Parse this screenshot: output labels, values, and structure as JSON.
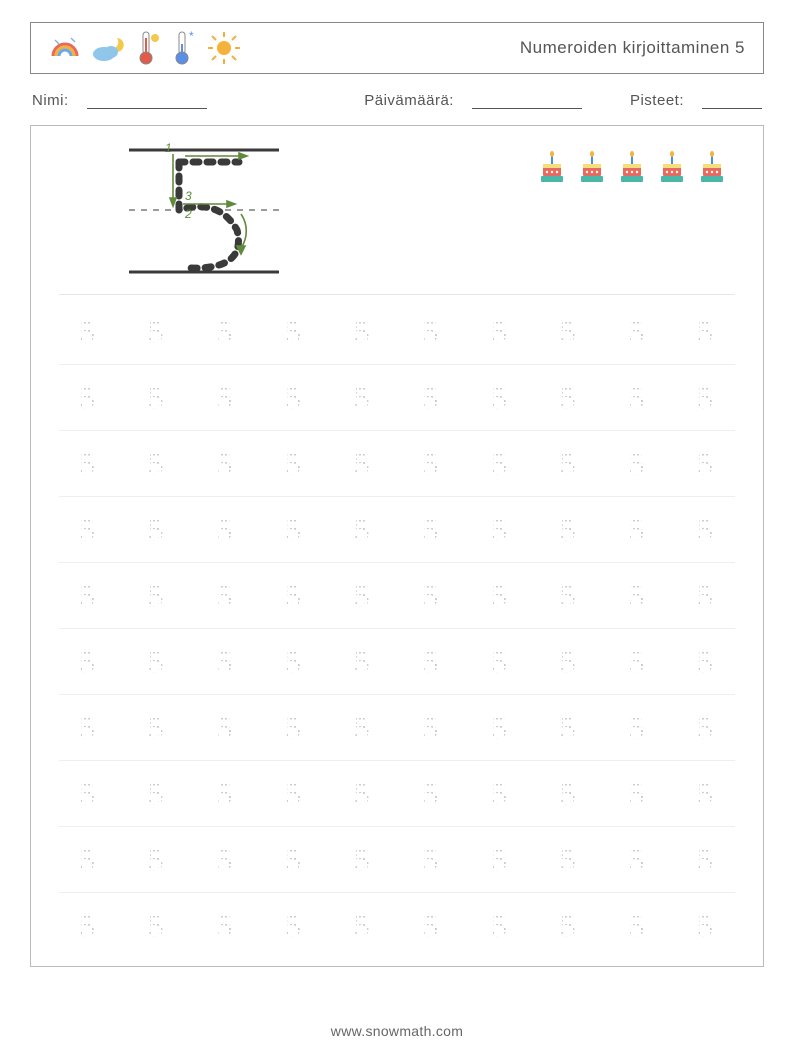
{
  "header": {
    "title": "Numeroiden kirjoittaminen 5",
    "icons": [
      "rainbow-icon",
      "cloud-moon-icon",
      "thermometer-hot-icon",
      "thermometer-cold-icon",
      "sun-icon"
    ]
  },
  "meta": {
    "name_label": "Nimi:",
    "date_label": "Päivämäärä:",
    "score_label": "Pisteet:"
  },
  "example": {
    "number": "5",
    "stroke_labels": [
      "1",
      "2",
      "3"
    ],
    "candle_count": 5
  },
  "practice": {
    "rows": 10,
    "cols": 10,
    "glyph": "5"
  },
  "footer": {
    "url": "www.snowmath.com"
  }
}
